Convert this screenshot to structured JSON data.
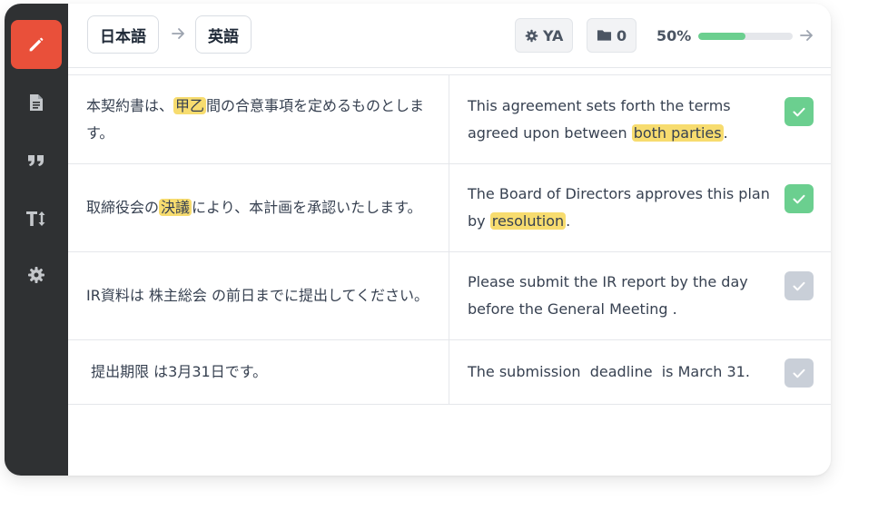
{
  "header": {
    "source_lang": "日本語",
    "target_lang": "英語",
    "settings_chip": "YA",
    "folder_count": "0",
    "progress_label": "50%",
    "progress_fraction": 0.5
  },
  "rows": [
    {
      "source": [
        "本契約書は、",
        "甲乙",
        "間の合意事項を定めるものとします。"
      ],
      "target": [
        "This agreement sets forth the terms agreed upon between ",
        "both parties",
        "."
      ],
      "confirmed": true
    },
    {
      "source": [
        "取締役会の",
        "決議",
        "により、本計画を承認いたします。"
      ],
      "target": [
        "The Board of Directors approves this plan by ",
        "resolution",
        "."
      ],
      "confirmed": true
    },
    {
      "source": [
        "IR資料は 株主総会 の前日までに提出してください。"
      ],
      "target": [
        "Please submit the IR report by the day before the  General Meeting ."
      ],
      "confirmed": false
    },
    {
      "source": [
        " 提出期限 は3月31日です。"
      ],
      "target": [
        "The submission  deadline  is March 31."
      ],
      "confirmed": false
    }
  ],
  "icons": {
    "sidebar": [
      "pencil-icon",
      "document-icon",
      "quote-icon",
      "text-size-icon",
      "gear-icon"
    ],
    "header": [
      "arrow-right-icon",
      "gear-icon",
      "folder-icon",
      "arrow-right-icon"
    ]
  },
  "colors": {
    "accent": "#e9503a",
    "sidebar": "#2f3133",
    "highlight": "#f7dc6f",
    "confirmed": "#6bcf8f",
    "unconfirmed": "#c9cfd8"
  }
}
